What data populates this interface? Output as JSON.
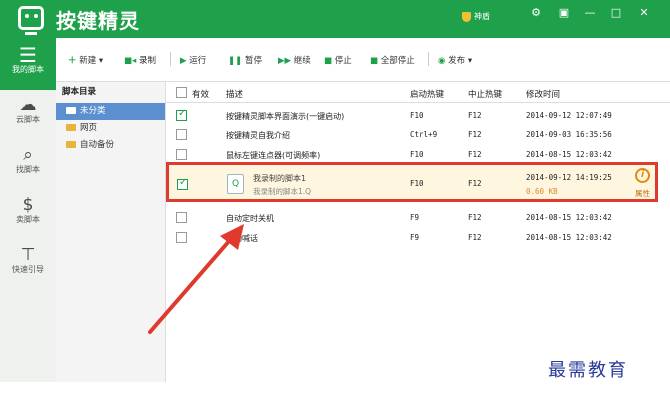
{
  "app": {
    "title": "按键精灵",
    "badge": "神盾"
  },
  "window_controls": [
    "⚙",
    "▣",
    "—",
    "□",
    "✕"
  ],
  "rail": [
    {
      "label": "我的脚本",
      "icon": "list-icon"
    },
    {
      "label": "云脚本",
      "icon": "cloud-icon"
    },
    {
      "label": "找脚本",
      "icon": "search-icon"
    },
    {
      "label": "卖脚本",
      "icon": "dollar-icon"
    },
    {
      "label": "快速引导",
      "icon": "signpost-icon"
    }
  ],
  "toolbar": {
    "new": "新建",
    "record": "录制",
    "run": "运行",
    "pause": "暂停",
    "resume": "继续",
    "stop": "停止",
    "stop_all": "全部停止",
    "publish": "发布"
  },
  "tree": {
    "header": "脚本目录",
    "items": [
      "未分类",
      "网页",
      "自动备份"
    ]
  },
  "table": {
    "headers": [
      "有效",
      "描述",
      "启动热键",
      "中止热键",
      "修改时间"
    ],
    "rows": [
      {
        "checked": true,
        "desc": "按键精灵脚本界面演示(一键启动)",
        "start": "F10",
        "stop": "F12",
        "time": "2014-09-12 12:07:49"
      },
      {
        "checked": false,
        "desc": "按键精灵自我介绍",
        "start": "Ctrl+9",
        "stop": "F12",
        "time": "2014-09-03 16:35:56"
      },
      {
        "checked": false,
        "desc": "鼠标左键连点器(可调频率)",
        "start": "F10",
        "stop": "F12",
        "time": "2014-08-15 12:03:42"
      },
      {
        "checked": false,
        "desc": "自动定时关机",
        "start": "F9",
        "stop": "F12",
        "time": "2014-08-15 12:03:42"
      },
      {
        "checked": false,
        "desc": "自动喊话",
        "start": "F9",
        "stop": "F12",
        "time": "2014-08-15 12:03:42"
      }
    ],
    "highlighted": {
      "checked": true,
      "name": "我录制的脚本1",
      "file": "我录制的脚本1.Q",
      "start": "F10",
      "stop": "F12",
      "time": "2014-09-12 14:19:25",
      "size": "0.60 KB",
      "attr_label": "属性"
    }
  },
  "watermark": "最需教育",
  "colors": {
    "brand": "#1fa04a",
    "highlight_border": "#e0392e",
    "arrow": "#e0392e"
  }
}
